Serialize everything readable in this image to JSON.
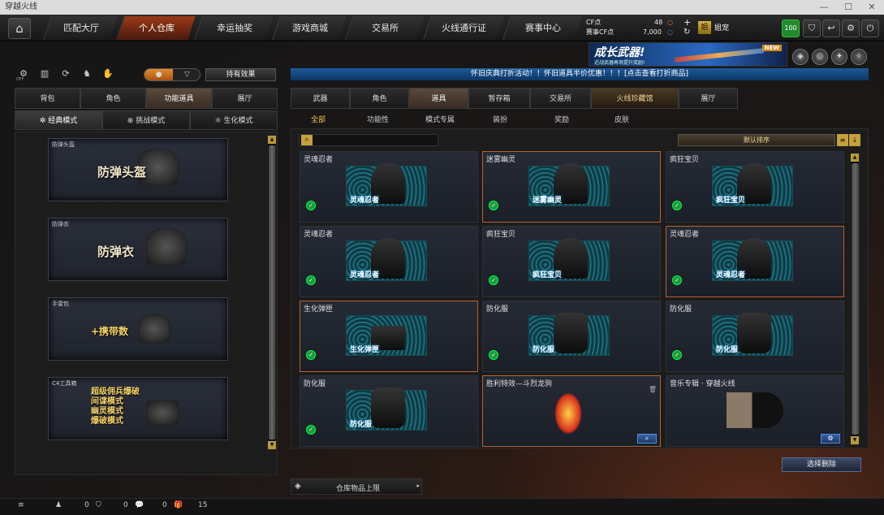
{
  "window": {
    "title": "穿越火线",
    "minimize": "—",
    "maximize": "☐",
    "close": "✕"
  },
  "nav": {
    "home_icon": "home-icon",
    "tabs": [
      "匹配大厅",
      "个人仓库",
      "幸运抽奖",
      "游戏商城",
      "交易所",
      "火线通行证",
      "赛事中心"
    ],
    "active": "个人仓库"
  },
  "currency": {
    "cf_label": "CF点",
    "cf_value": "48",
    "cf_plus": "+",
    "cf_dot": "○",
    "ct_label": "赛事CF点",
    "ct_value": "7,000",
    "refresh": "↻",
    "ct_dot": "○"
  },
  "user": {
    "name": "姐宠",
    "badge": "姐",
    "level": "100"
  },
  "banner": {
    "title": "成长武器!",
    "subtitle": "近战武器再项提升奖励!",
    "new_tag": "NEW"
  },
  "left": {
    "toggle": {
      "a": "●",
      "b": "▽"
    },
    "effect_btn": "持有效果",
    "off_label": "OFF",
    "tabs": [
      "背包",
      "角色",
      "功能道具",
      "展厅"
    ],
    "active_tab": "功能道具",
    "modes": [
      {
        "label": "经典模式",
        "icon": "✲"
      },
      {
        "label": "挑战模式",
        "icon": "⊕"
      },
      {
        "label": "生化模式",
        "icon": "⚛"
      }
    ],
    "active_mode": "经典模式",
    "items": [
      {
        "cat": "防弹头盔",
        "title": "防弹头盔"
      },
      {
        "cat": "防弹衣",
        "title": "防弹衣"
      },
      {
        "cat": "手雷包",
        "title": "+携带数"
      },
      {
        "cat": "C4工具箱",
        "lines": [
          "超级佣兵爆破",
          "间谍模式",
          "幽灵模式",
          "爆破模式"
        ]
      }
    ]
  },
  "ticker": "怀旧庆典打折活动！！怀旧道具半价优惠！！！[点击查看打折商品]",
  "right": {
    "tabs": [
      "武器",
      "角色",
      "道具",
      "暂存箱",
      "交易所",
      "火线珍藏馆",
      "展厅"
    ],
    "active_tab": "道具",
    "subtabs": [
      "全部",
      "功能性",
      "模式专属",
      "装扮",
      "奖励",
      "皮肤"
    ],
    "active_sub": "全部",
    "search_placeholder": "",
    "sort": "默认排序",
    "sort_list": "≡",
    "sort_down": "↓",
    "cards": [
      {
        "name": "灵魂忍者",
        "label": "灵魂忍者",
        "hl": false
      },
      {
        "name": "迷雾幽灵",
        "label": "迷雾幽灵",
        "hl": true
      },
      {
        "name": "疯狂宝贝",
        "label": "疯狂宝贝",
        "hl": false
      },
      {
        "name": "灵魂忍者",
        "label": "灵魂忍者",
        "hl": false
      },
      {
        "name": "疯狂宝贝",
        "label": "疯狂宝贝",
        "hl": false
      },
      {
        "name": "灵魂忍者",
        "label": "灵魂忍者",
        "hl": true
      },
      {
        "name": "生化弹匣",
        "label": "生化弹匣",
        "hl": true
      },
      {
        "name": "防化服",
        "label": "防化服",
        "hl": false
      },
      {
        "name": "防化服",
        "label": "防化服",
        "hl": false
      },
      {
        "name": "防化服",
        "label": "防化服",
        "hl": false
      },
      {
        "name": "胜利特效—斗烈龙驹",
        "label": "",
        "hl": true
      },
      {
        "name": "音乐专辑 · 穿越火线",
        "label": "",
        "hl": false
      }
    ],
    "batch_delete": "选择删除",
    "storage_limit": "仓库物品上限"
  },
  "bottombar": {
    "menu": "≡",
    "c1": "0",
    "c2": "0",
    "c3": "0",
    "c4": "15"
  }
}
